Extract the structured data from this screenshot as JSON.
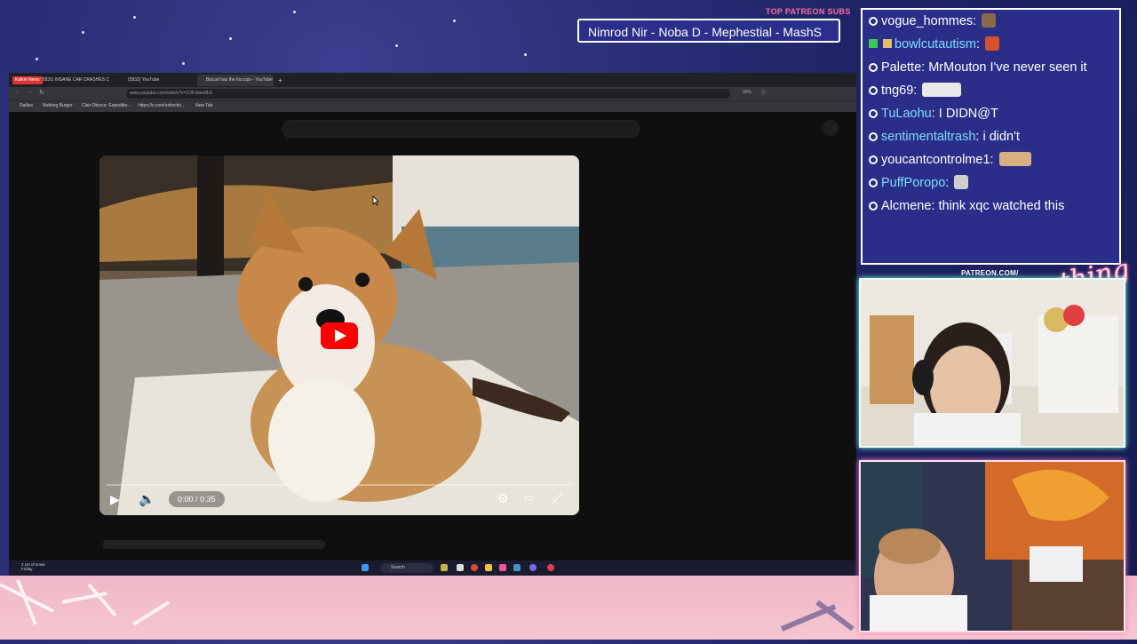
{
  "ticker": {
    "label": "TOP PATREON SUBS",
    "text": "Nimrod Nir - Noba D - Mephestial - MashS"
  },
  "browser": {
    "tabs": [
      {
        "badge": "Kalkin News",
        "label": "(5831) INSANE CAR CRASHES C"
      },
      {
        "label": "(5832) YouTube"
      },
      {
        "label": "Biscuit has the hiccups - YouTube",
        "active": true
      }
    ],
    "new_tab_label": "+",
    "url": "www.youtube.com/watch?v=1OF3oem8Jc",
    "zoom": "90%",
    "bookmarks": [
      "Dailies",
      "Nothing Burger",
      "Clair Obscur: Expeditio...",
      "https://x.com/extinctio...",
      "New Tab"
    ]
  },
  "video": {
    "time": "0:00 / 0:35",
    "progress": 0,
    "state": "paused"
  },
  "taskbar": {
    "weather_line1": "2 cm of snow",
    "weather_line2": "Friday",
    "search_label": "Search"
  },
  "chat": {
    "messages": [
      {
        "user": "vogue_hommes",
        "text": "",
        "color": "white",
        "emote_color": "#8a6a4a"
      },
      {
        "user": "bowlcutautism",
        "text": "",
        "color": "cyan",
        "badge": true,
        "emote_color": "#d6502c"
      },
      {
        "user": "Palette",
        "text": "MrMouton I've never seen it",
        "color": "white"
      },
      {
        "user": "tng69",
        "text": "",
        "color": "white",
        "emote_color": "#e8e8e8"
      },
      {
        "user": "TuLaohu",
        "text": "I DIDN@T",
        "color": "cyan"
      },
      {
        "user": "sentimentaltrash",
        "text": "i didn't",
        "color": "cyan"
      },
      {
        "user": "youcantcontrolme1",
        "text": "",
        "color": "white",
        "emote_color": "#d8b080"
      },
      {
        "user": "PuffPoropo",
        "text": "",
        "color": "cyan",
        "emote_color": "#cfcfcf"
      },
      {
        "user": "Alcmene",
        "text": "think xqc watched this",
        "color": "white"
      }
    ]
  },
  "patreon_url": "PATREON.COM/",
  "logo_text": "Anything Else?",
  "colors": {
    "accent_pink": "#ff6aa3",
    "chat_bg": "#2a2e88",
    "username_cyan": "#7fdcff",
    "youtube_red": "#ff0000"
  }
}
